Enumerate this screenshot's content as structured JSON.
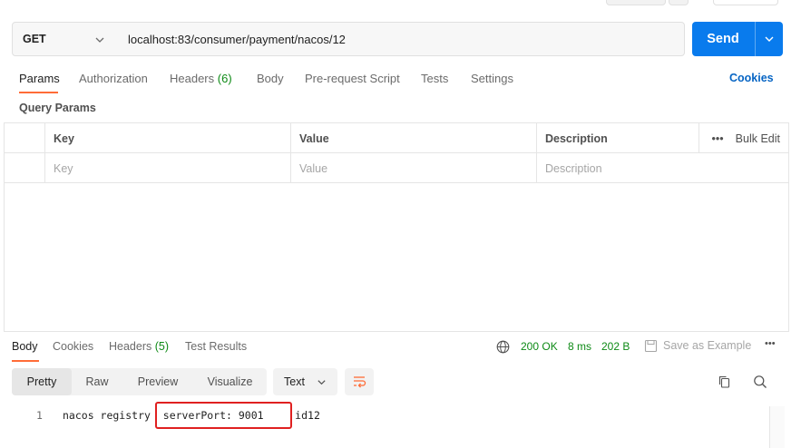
{
  "request": {
    "method": "GET",
    "url": "localhost:83/consumer/payment/nacos/12",
    "send_label": "Send"
  },
  "request_tabs": [
    {
      "label": "Params",
      "count": ""
    },
    {
      "label": "Authorization",
      "count": ""
    },
    {
      "label": "Headers",
      "count": "(6)"
    },
    {
      "label": "Body",
      "count": ""
    },
    {
      "label": "Pre-request Script",
      "count": ""
    },
    {
      "label": "Tests",
      "count": ""
    },
    {
      "label": "Settings",
      "count": ""
    }
  ],
  "cookies_label": "Cookies",
  "query_params": {
    "title": "Query Params",
    "headers": [
      "Key",
      "Value",
      "Description"
    ],
    "bulk_edit": "Bulk Edit",
    "placeholders": [
      "Key",
      "Value",
      "Description"
    ]
  },
  "response": {
    "tabs": [
      {
        "label": "Body",
        "count": ""
      },
      {
        "label": "Cookies",
        "count": ""
      },
      {
        "label": "Headers",
        "count": "(5)"
      },
      {
        "label": "Test Results",
        "count": ""
      }
    ],
    "status": "200 OK",
    "time": "8 ms",
    "size": "202 B",
    "save_label": "Save as Example",
    "formats": [
      "Pretty",
      "Raw",
      "Preview",
      "Visualize"
    ],
    "text_type": "Text",
    "line_number": "1",
    "body_line": "nacos registry  serverPort: 9001     id12"
  },
  "colors": {
    "send": "#097bed",
    "tab_underline": "#ff6c37",
    "status_green": "#0e8a16",
    "highlight_box": "#e02020"
  }
}
